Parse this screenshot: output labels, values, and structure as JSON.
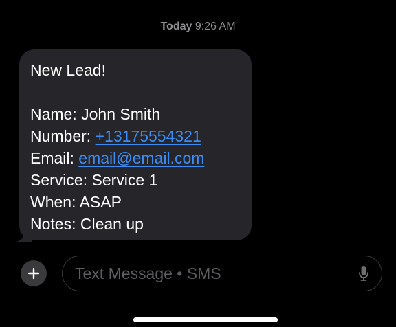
{
  "conversation": {
    "timestamp_day": "Today",
    "timestamp_time": "9:26 AM"
  },
  "message": {
    "lines": {
      "heading": "New Lead!",
      "name": "Name: John Smith",
      "number_label": "Number: ",
      "number_value": "+13175554321",
      "email_label": "Email: ",
      "email_value": "email@email.com",
      "service": "Service: Service 1",
      "when": "When: ASAP",
      "notes": "Notes: Clean up"
    },
    "colors": {
      "bubble": "#26252a",
      "link": "#3b8df5"
    }
  },
  "composer": {
    "placeholder": "Text Message • SMS",
    "plus_icon": "plus-icon",
    "mic_icon": "microphone-icon"
  }
}
